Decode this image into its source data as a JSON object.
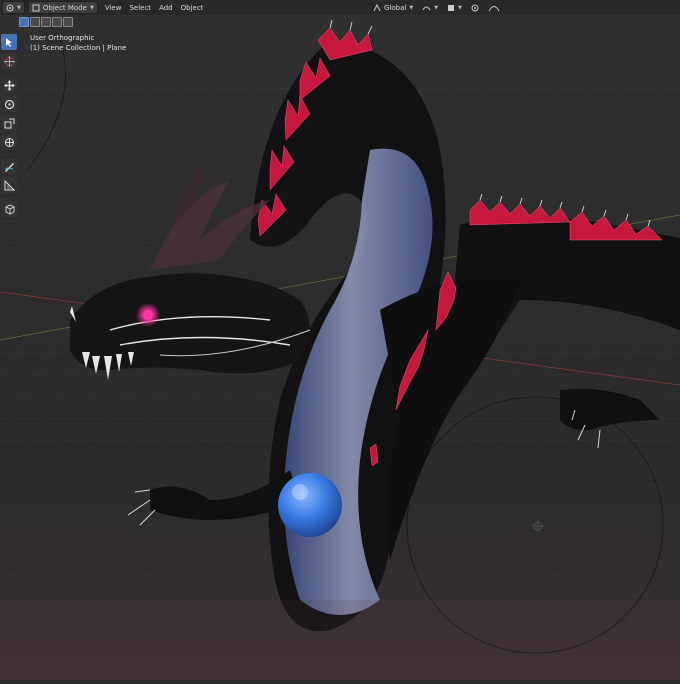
{
  "header": {
    "mode_label": "Object Mode",
    "menus": [
      "View",
      "Select",
      "Add",
      "Object"
    ],
    "transform_orientation": "Global"
  },
  "viewport": {
    "view_label": "User Orthographic",
    "collection_label": "(1) Scene Collection | Plane"
  },
  "toolbar": {
    "tools": [
      "select-box-icon",
      "cursor-icon",
      "move-icon",
      "rotate-icon",
      "scale-icon",
      "transform-icon",
      "annotate-icon",
      "measure-icon",
      "add-cube-icon"
    ],
    "active_tool": "select-box-icon"
  },
  "colors": {
    "accent": "#4772b3",
    "background": "#2a2a2a",
    "spikes": "#c8173d",
    "eye": "#ff2fa0",
    "orb": "#3a7ce6"
  }
}
